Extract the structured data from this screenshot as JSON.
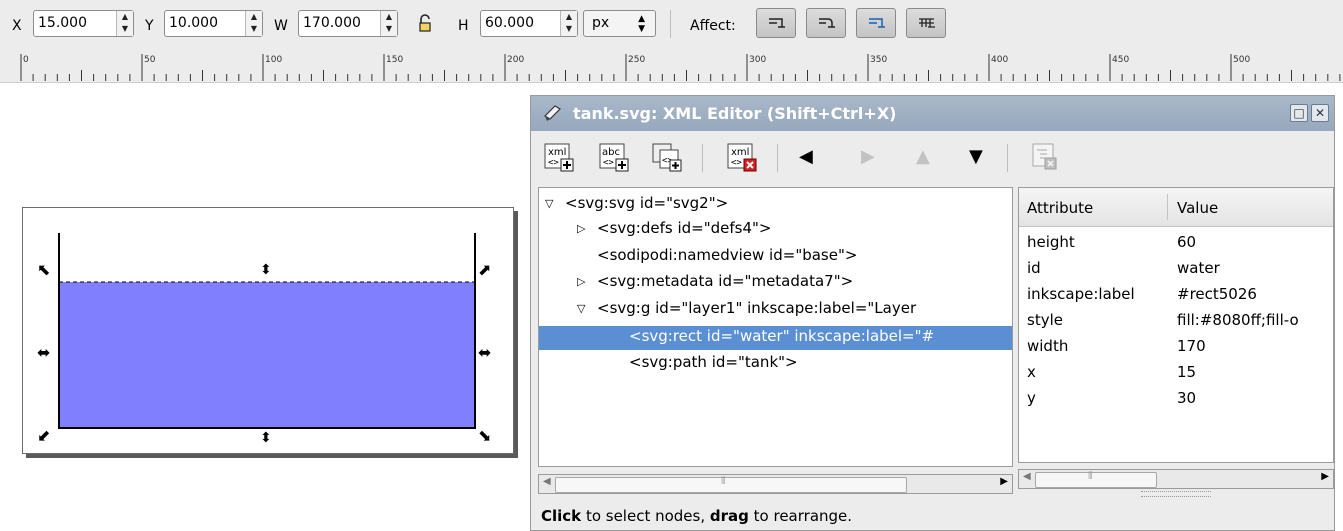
{
  "toolbar": {
    "x_label": "X",
    "x_value": "15.000",
    "y_label": "Y",
    "y_value": "10.000",
    "w_label": "W",
    "w_value": "170.000",
    "h_label": "H",
    "h_value": "60.000",
    "unit": "px",
    "affect_label": "Affect:"
  },
  "ruler": {
    "labels": [
      "0",
      "50",
      "100",
      "150",
      "200",
      "250",
      "300",
      "350",
      "400",
      "450",
      "500"
    ]
  },
  "xml_editor": {
    "title": "tank.svg: XML Editor (Shift+Ctrl+X)",
    "tree": [
      {
        "text": "<svg:svg id=\"svg2\">",
        "expander": "▽"
      },
      {
        "text": "<svg:defs id=\"defs4\">",
        "expander": "▷"
      },
      {
        "text": "<sodipodi:namedview id=\"base\">",
        "expander": ""
      },
      {
        "text": "<svg:metadata id=\"metadata7\">",
        "expander": "▷"
      },
      {
        "text": "<svg:g id=\"layer1\" inkscape:label=\"Layer",
        "expander": "▽"
      },
      {
        "text": "<svg:rect id=\"water\" inkscape:label=\"#",
        "expander": "",
        "selected": true
      },
      {
        "text": "<svg:path id=\"tank\">",
        "expander": ""
      }
    ],
    "attr_header": "Attribute",
    "value_header": "Value",
    "attributes": [
      {
        "name": "height",
        "value": "60"
      },
      {
        "name": "id",
        "value": "water"
      },
      {
        "name": "inkscape:label",
        "value": "#rect5026"
      },
      {
        "name": "style",
        "value": "fill:#8080ff;fill-o"
      },
      {
        "name": "width",
        "value": "170"
      },
      {
        "name": "x",
        "value": "15"
      },
      {
        "name": "y",
        "value": "30"
      }
    ],
    "status": {
      "click": "Click",
      "text1": " to select nodes, ",
      "drag": "drag",
      "text2": " to rearrange."
    }
  },
  "colors": {
    "water_fill": "#8080ff",
    "selection": "#5b8fd4",
    "titlebar": "#a9b8c9"
  }
}
